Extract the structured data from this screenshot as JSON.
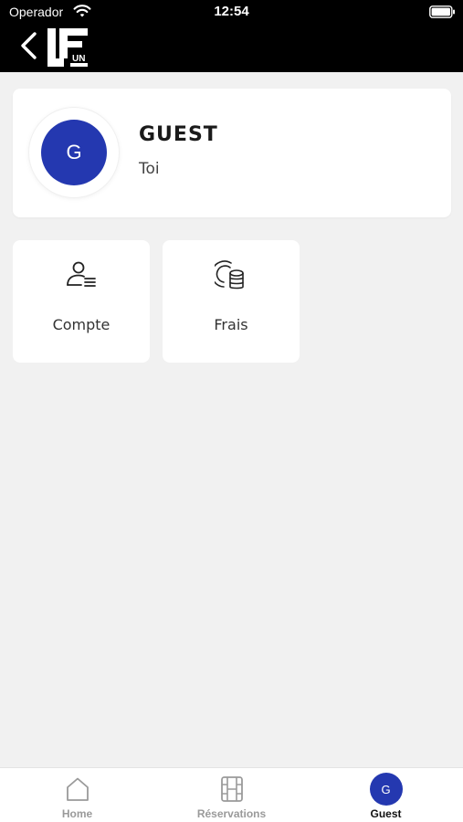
{
  "status_bar": {
    "carrier": "Operador",
    "time": "12:54"
  },
  "header": {
    "back_icon": "chevron-left-icon",
    "logo_alt": "LEUN"
  },
  "profile": {
    "avatar_initial": "G",
    "name": "GUEST",
    "subtitle": "Toi",
    "avatar_color": "#2438b0"
  },
  "tiles": [
    {
      "label": "Compte",
      "icon": "account-list-icon"
    },
    {
      "label": "Frais",
      "icon": "coins-icon"
    }
  ],
  "tabbar": {
    "items": [
      {
        "label": "Home",
        "icon": "home-icon"
      },
      {
        "label": "Réservations",
        "icon": "film-icon"
      },
      {
        "label": "Guest",
        "avatar_initial": "G",
        "active": true
      }
    ]
  },
  "colors": {
    "accent": "#2438b0",
    "header_bg": "#000000",
    "page_bg": "#f1f1f1"
  }
}
